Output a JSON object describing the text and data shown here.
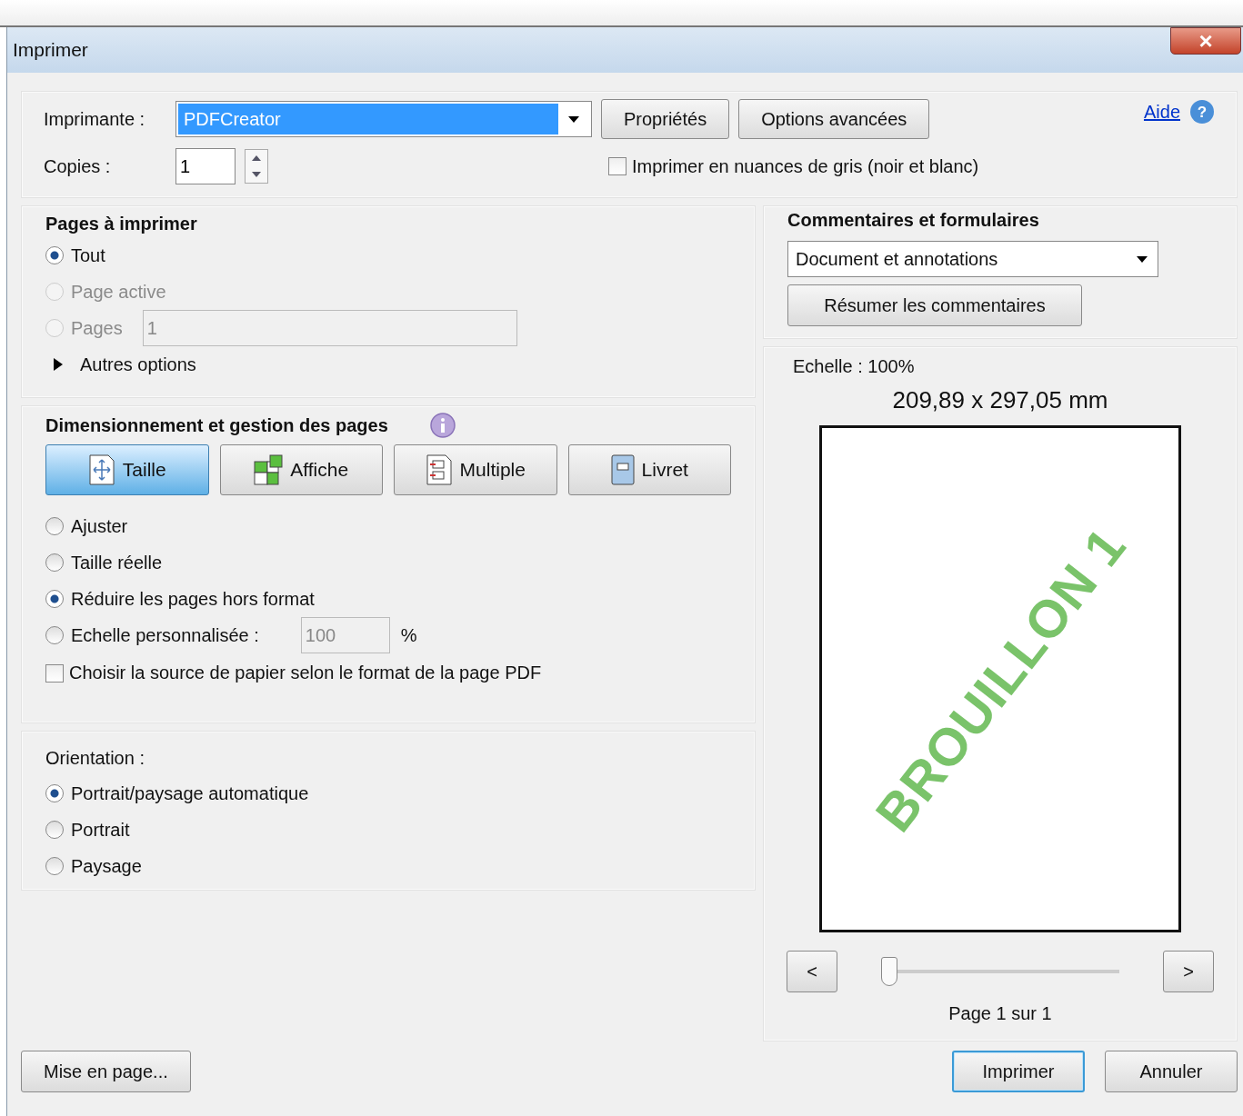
{
  "window": {
    "title": "Imprimer",
    "close": "×"
  },
  "printer": {
    "label": "Imprimante :",
    "value": "PDFCreator",
    "buttons": [
      "Propriétés",
      "Options avancées"
    ],
    "help": "Aide",
    "help_icon": "?"
  },
  "copies": {
    "label": "Copies :",
    "value": "1"
  },
  "grayscale": {
    "label": "Imprimer en nuances de gris (noir et blanc)",
    "checked": false
  },
  "pages_to_print": {
    "title": "Pages à imprimer",
    "options": [
      {
        "label": "Tout",
        "selected": true,
        "disabled": false
      },
      {
        "label": "Page active",
        "selected": false,
        "disabled": true
      },
      {
        "label": "Pages",
        "selected": false,
        "disabled": true,
        "field": "1"
      }
    ],
    "more": {
      "label": "Autres options",
      "expanded": false
    }
  },
  "sizing": {
    "title": "Dimensionnement et gestion des pages",
    "tabs": [
      {
        "label": "Taille",
        "kind": "size",
        "selected": true
      },
      {
        "label": "Affiche",
        "kind": "poster",
        "selected": false
      },
      {
        "label": "Multiple",
        "kind": "multiple",
        "selected": false
      },
      {
        "label": "Livret",
        "kind": "booklet",
        "selected": false
      }
    ],
    "options": [
      {
        "label": "Ajuster",
        "selected": false
      },
      {
        "label": "Taille réelle",
        "selected": false
      },
      {
        "label": "Réduire les pages hors format",
        "selected": true
      },
      {
        "label": "Echelle personnalisée :",
        "selected": false,
        "field": "100",
        "unit": "%"
      }
    ],
    "paper_source": {
      "label": "Choisir la source de papier selon le format de la page PDF",
      "checked": false
    }
  },
  "orientation": {
    "title": "Orientation :",
    "options": [
      {
        "label": "Portrait/paysage automatique",
        "selected": true
      },
      {
        "label": "Portrait",
        "selected": false
      },
      {
        "label": "Paysage",
        "selected": false
      }
    ]
  },
  "comments": {
    "title": "Commentaires et formulaires",
    "value": "Document et annotations",
    "button": "Résumer les commentaires"
  },
  "preview": {
    "scale": "Echelle : 100%",
    "size": "209,89 x 297,05 mm",
    "watermark": "BROUILLON 1",
    "prev": "<",
    "next": ">",
    "level": 0,
    "page": "Page 1 sur 1"
  },
  "page_setup": "Mise en page...",
  "buttons": [
    {
      "label": "Imprimer",
      "default": true
    },
    {
      "label": "Annuler",
      "default": false
    }
  ]
}
